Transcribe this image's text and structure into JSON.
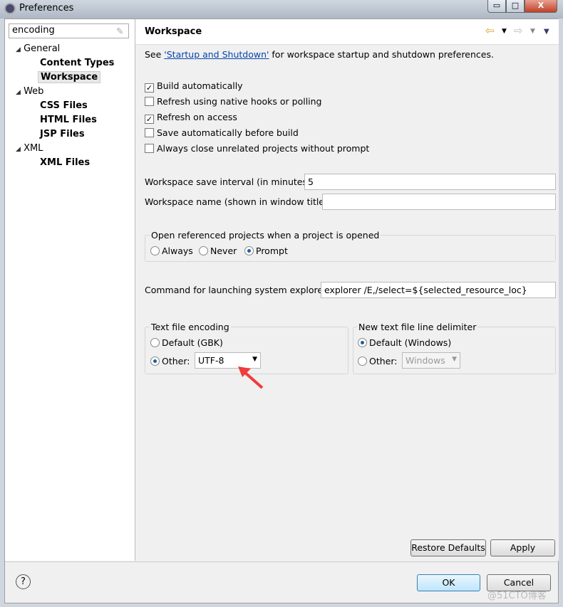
{
  "window": {
    "title": "Preferences",
    "minimize": "▭",
    "maximize": "□",
    "close": "X"
  },
  "sidebar": {
    "filter_value": "encoding",
    "tree": [
      {
        "label": "General",
        "children": [
          "Content Types",
          "Workspace"
        ]
      },
      {
        "label": "Web",
        "children": [
          "CSS Files",
          "HTML Files",
          "JSP Files"
        ]
      },
      {
        "label": "XML",
        "children": [
          "XML Files"
        ]
      }
    ],
    "selected": "Workspace"
  },
  "page": {
    "title": "Workspace",
    "intro_prefix": "See ",
    "intro_link": "'Startup and Shutdown'",
    "intro_suffix": " for workspace startup and shutdown preferences.",
    "checkboxes": [
      {
        "label": "Build automatically",
        "checked": true
      },
      {
        "label": "Refresh using native hooks or polling",
        "checked": false
      },
      {
        "label": "Refresh on access",
        "checked": true
      },
      {
        "label": "Save automatically before build",
        "checked": false
      },
      {
        "label": "Always close unrelated projects without prompt",
        "checked": false
      }
    ],
    "save_interval_label": "Workspace save interval (in minutes):",
    "save_interval_value": "5",
    "workspace_name_label": "Workspace name (shown in window title):",
    "workspace_name_value": "",
    "open_projects": {
      "legend": "Open referenced projects when a project is opened",
      "options": [
        "Always",
        "Never",
        "Prompt"
      ],
      "selected": "Prompt"
    },
    "explorer_label": "Command for launching system explorer:",
    "explorer_value": "explorer /E,/select=${selected_resource_loc}",
    "encoding": {
      "legend": "Text file encoding",
      "default_label": "Default (GBK)",
      "other_label": "Other:",
      "other_value": "UTF-8",
      "selected": "Other"
    },
    "delimiter": {
      "legend": "New text file line delimiter",
      "default_label": "Default (Windows)",
      "other_label": "Other:",
      "other_value": "Windows",
      "selected": "Default"
    },
    "restore_defaults": "Restore Defaults",
    "apply": "Apply"
  },
  "footer": {
    "help": "?",
    "ok": "OK",
    "cancel": "Cancel"
  },
  "watermark": "@51CTO博客",
  "colors": {
    "arrow_annotation": "#f03c3c",
    "radio_selected": "#1d5e9f"
  }
}
